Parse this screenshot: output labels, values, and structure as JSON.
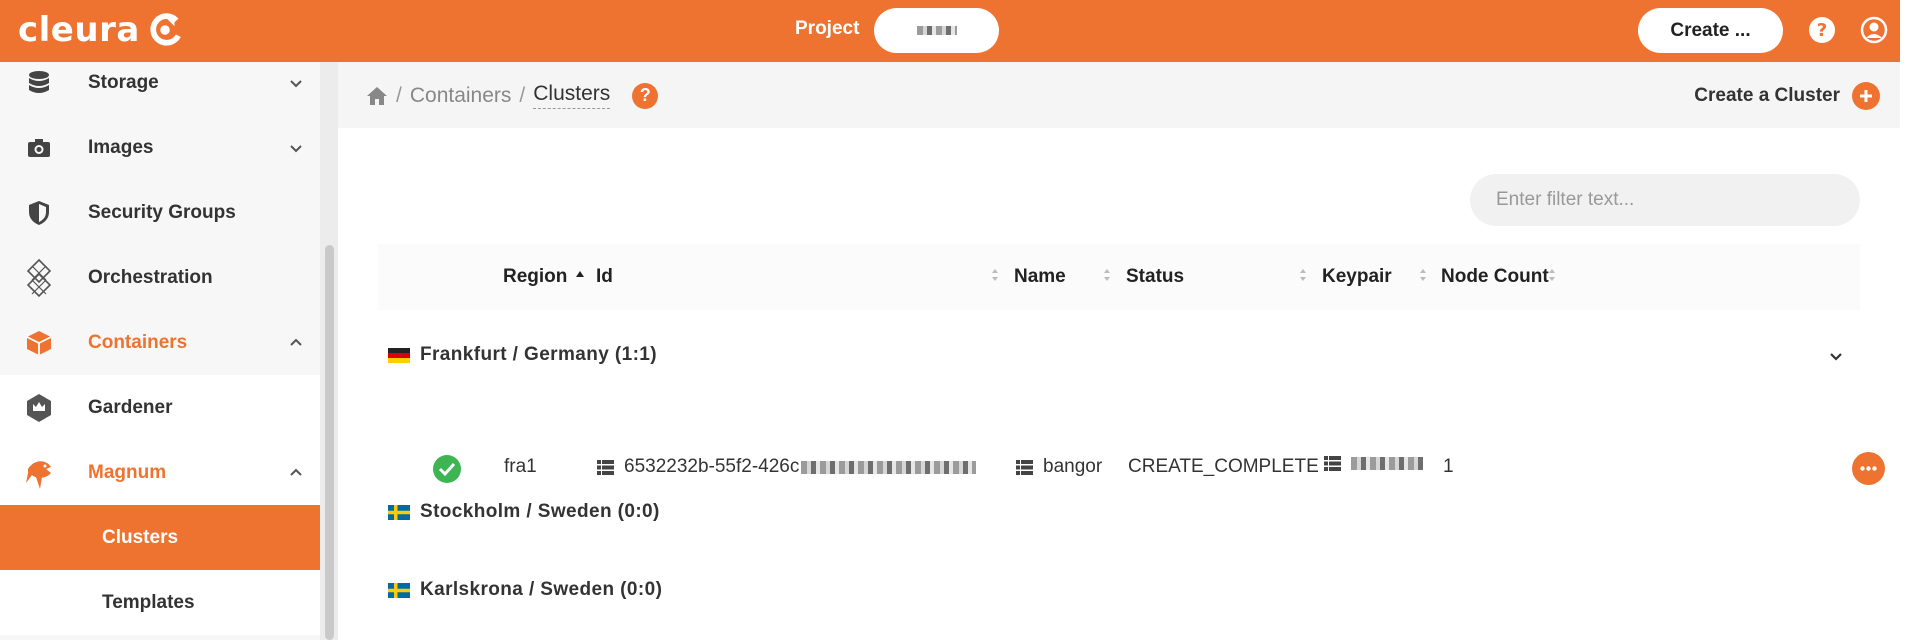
{
  "topbar": {
    "logo_text": "cleura",
    "project_label": "Project",
    "create_label": "Create ..."
  },
  "sidebar": {
    "items": [
      {
        "label": "Storage",
        "icon": "database-icon"
      },
      {
        "label": "Images",
        "icon": "camera-icon"
      },
      {
        "label": "Security Groups",
        "icon": "shield-icon"
      },
      {
        "label": "Orchestration",
        "icon": "orchestration-icon"
      },
      {
        "label": "Containers",
        "icon": "box-icon"
      },
      {
        "label": "Gardener",
        "icon": "gardener-icon"
      },
      {
        "label": "Magnum",
        "icon": "magnum-fish-icon"
      },
      {
        "label": "Clusters"
      },
      {
        "label": "Templates"
      }
    ]
  },
  "breadcrumb": {
    "containers": "Containers",
    "clusters": "Clusters",
    "sep": "/"
  },
  "header": {
    "create_cluster": "Create a Cluster"
  },
  "filter": {
    "placeholder": "Enter filter text..."
  },
  "table": {
    "columns": [
      "Region",
      "Id",
      "Name",
      "Status",
      "Keypair",
      "Node Count"
    ],
    "groups": [
      {
        "label": "Frankfurt / Germany (1:1)",
        "flag": "germany"
      },
      {
        "label": "Stockholm / Sweden (0:0)",
        "flag": "sweden"
      },
      {
        "label": "Karlskrona / Sweden (0:0)",
        "flag": "sweden"
      }
    ],
    "rows": [
      {
        "region": "fra1",
        "id": "6532232b-55f2-426c",
        "name": "bangor",
        "status": "CREATE_COMPLETE",
        "node_count": "1"
      }
    ]
  },
  "colors": {
    "accent": "#ee7330",
    "success": "#3cb552"
  }
}
